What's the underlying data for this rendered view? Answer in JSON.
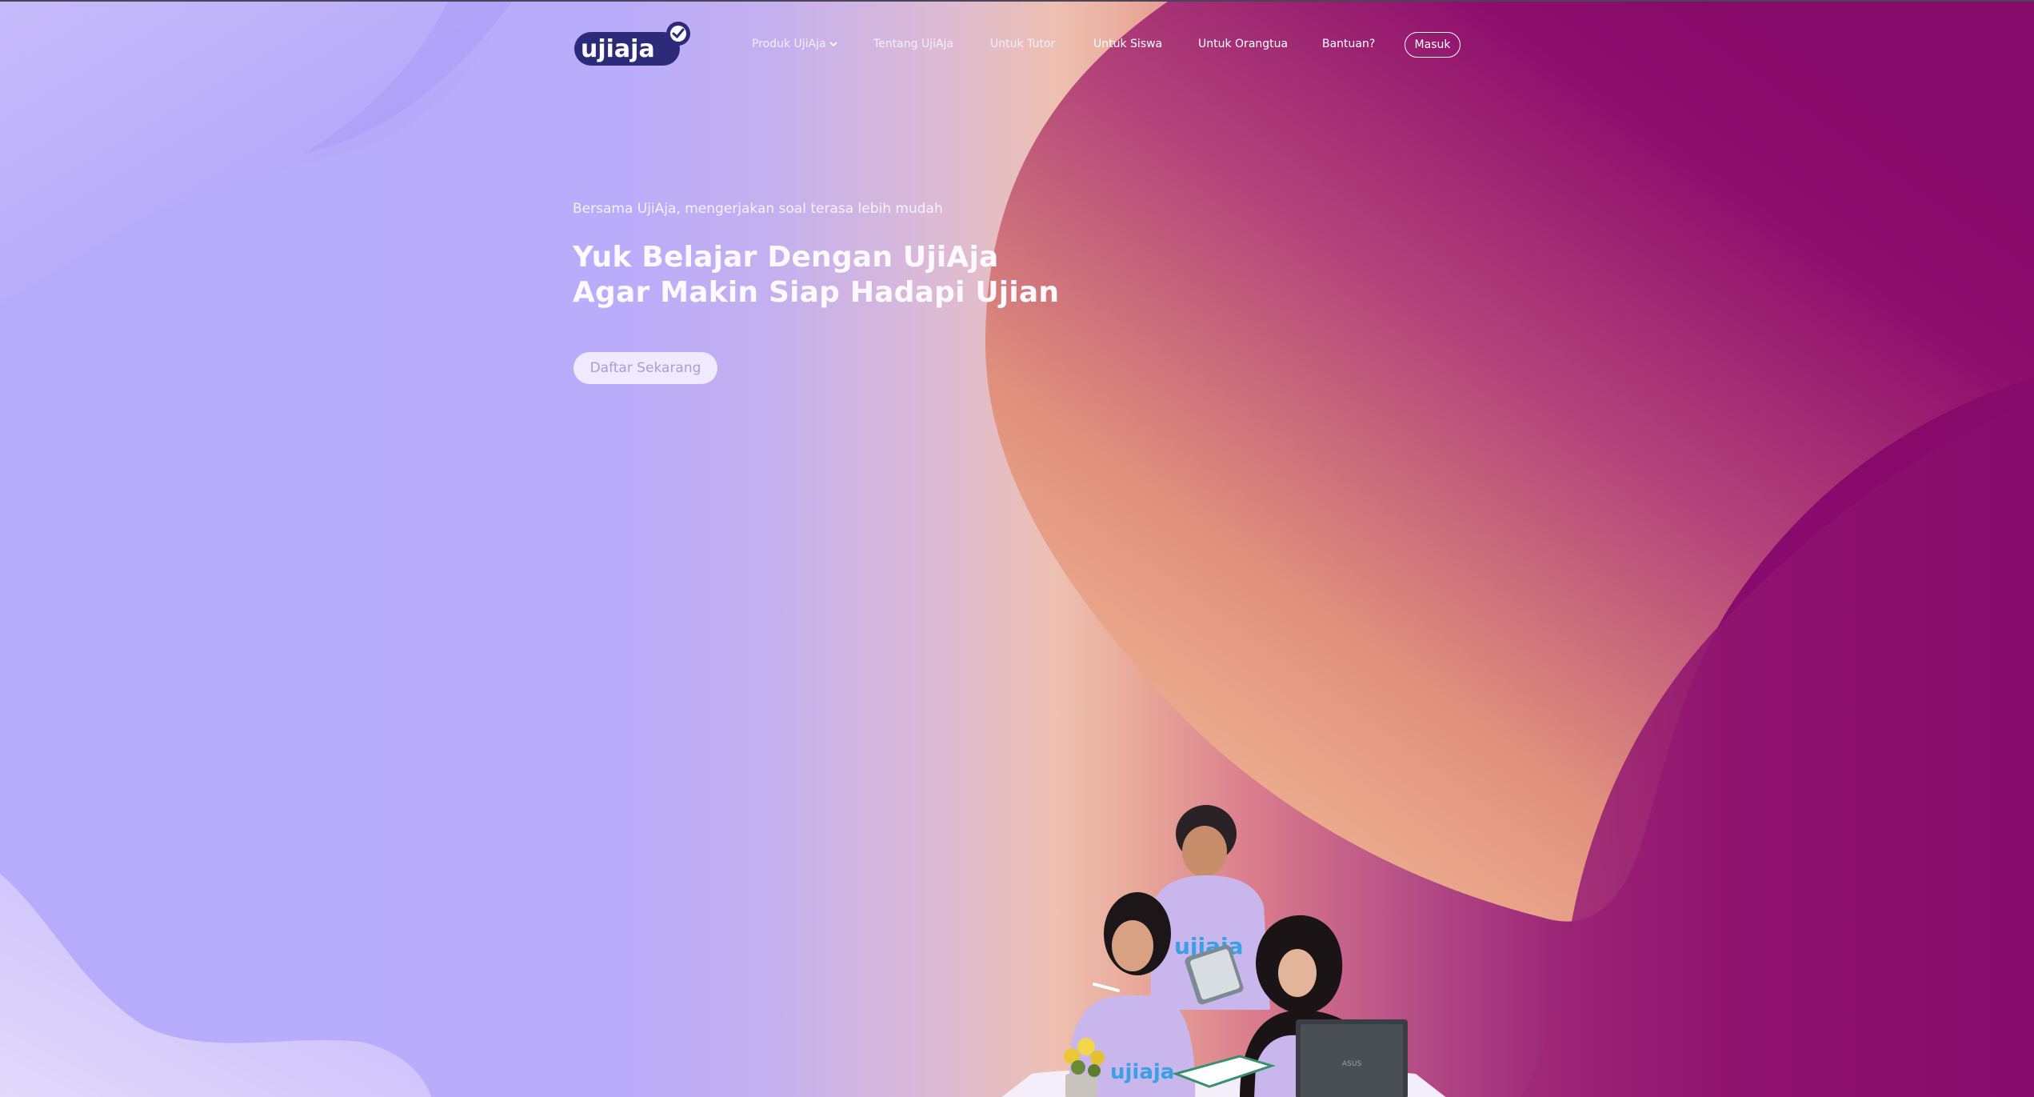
{
  "brand": {
    "logo_text": "ujiaja",
    "logo_color": "#2e2a7a",
    "logo_badge_color": "#ffffff"
  },
  "nav": {
    "items": [
      {
        "label": "Produk UjiAja",
        "has_dropdown": true
      },
      {
        "label": "Tentang UjiAja"
      },
      {
        "label": "Untuk Tutor"
      },
      {
        "label": "Untuk Siswa"
      },
      {
        "label": "Untuk Orangtua"
      },
      {
        "label": "Bantuan?"
      }
    ],
    "login_label": "Masuk",
    "chevron_icon": "chevron-down-icon"
  },
  "hero": {
    "subtitle": "Bersama UjiAja, mengerjakan soal terasa lebih mudah",
    "headline_line1": "Yuk Belajar Dengan UjiAja",
    "headline_line2": "Agar Makin Siap Hadapi Ujian",
    "cta_label": "Daftar Sekarang"
  },
  "photo": {
    "shirt_text": "ujiaja",
    "laptop_text": "ASUS"
  },
  "colors": {
    "lavender": "#b9acfd",
    "peach": "#eec0b1",
    "magenta": "#860a6a",
    "white": "#ffffff"
  }
}
